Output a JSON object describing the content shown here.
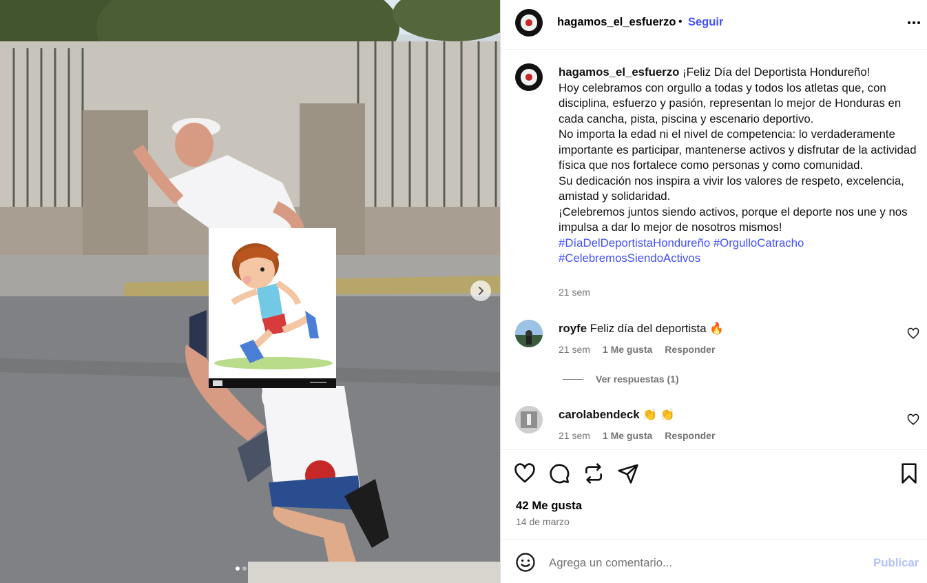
{
  "post": {
    "username": "hagamos_el_esfuerzo",
    "separator": "•",
    "follow_label": "Seguir",
    "more_icon": "more-horizontal-icon"
  },
  "caption": {
    "username": "hagamos_el_esfuerzo",
    "first_line": "¡Feliz Día del Deportista Hondureño!",
    "paragraphs": [
      "Hoy celebramos con orgullo a todas y todos los atletas que, con disciplina, esfuerzo y pasión, representan lo mejor de Honduras en cada cancha, pista, piscina y escenario deportivo.",
      "No importa la edad ni el nivel de competencia: lo verdaderamente importante es participar, mantenerse activos y disfrutar de la actividad física que nos fortalece como personas y como comunidad.",
      "Su dedicación nos inspira a vivir los valores de respeto, excelencia, amistad y solidaridad.",
      "¡Celebremos juntos siendo activos, porque el deporte nos une y nos impulsa a dar lo mejor de nosotros mismos!"
    ],
    "hashtags": [
      "#DíaDelDeportistaHondureño",
      "#OrgulloCatracho",
      "#CelebremosSiendoActivos"
    ],
    "time": "21 sem"
  },
  "comments": [
    {
      "username": "royfe",
      "text": "Feliz día del deportista",
      "emoji": "🔥",
      "time": "21 sem",
      "likes": "1 Me gusta",
      "reply": "Responder"
    },
    {
      "username": "carolabendeck",
      "text": "",
      "emoji": "👏 👏",
      "time": "21 sem",
      "likes": "1 Me gusta",
      "reply": "Responder"
    }
  ],
  "view_replies": "Ver respuestas (1)",
  "actions": {
    "icons": [
      "heart-icon",
      "comment-icon",
      "repost-icon",
      "share-icon",
      "bookmark-icon"
    ]
  },
  "likes_count": "42 Me gusta",
  "post_date": "14 de marzo",
  "comment_bar": {
    "placeholder": "Agrega un comentario...",
    "publish_label": "Publicar"
  },
  "carousel": {
    "total_slides": 2,
    "current_slide": 1
  }
}
